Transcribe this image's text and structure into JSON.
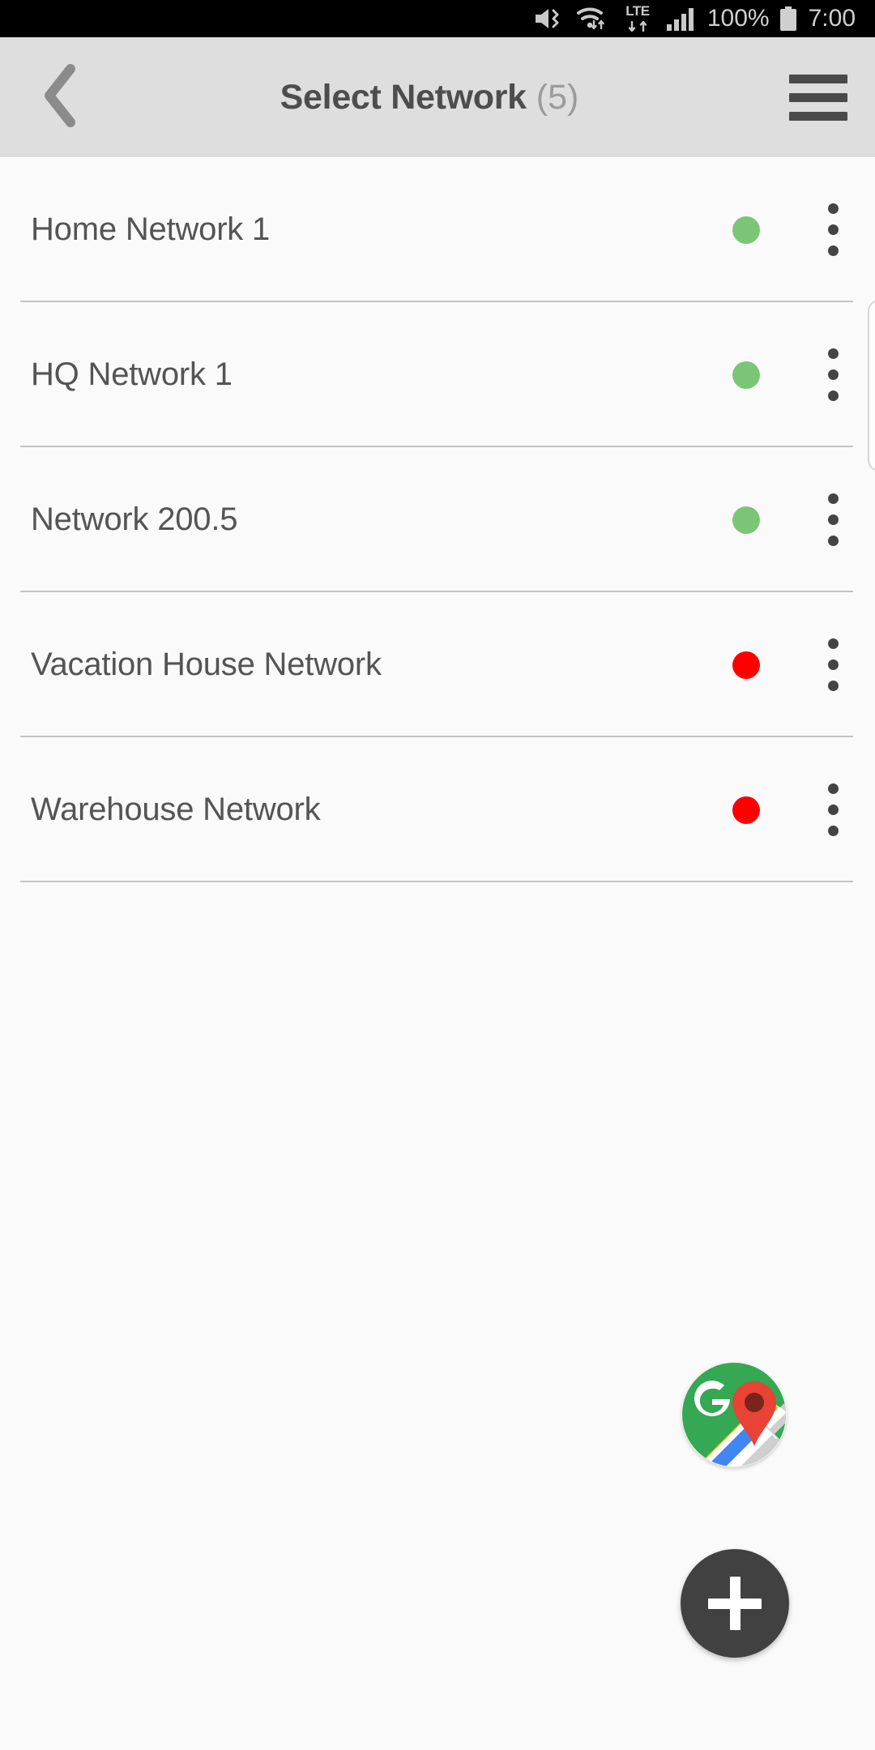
{
  "status_bar": {
    "icons": [
      "mute-icon",
      "wifi-icon",
      "lte-icon",
      "signal-bars-icon",
      "battery-icon"
    ],
    "battery_percent": "100%",
    "lte_label": "LTE",
    "time": "7:00"
  },
  "app_bar": {
    "back_icon": "chevron-left-icon",
    "title": "Select Network",
    "count": "(5)",
    "menu_icon": "hamburger-menu-icon"
  },
  "network_list": {
    "rows": [
      {
        "name": "Home Network 1",
        "status": "online",
        "status_color": "#7cc576",
        "menu_icon": "more-vertical-icon"
      },
      {
        "name": "HQ Network 1",
        "status": "online",
        "status_color": "#7cc576",
        "menu_icon": "more-vertical-icon"
      },
      {
        "name": "Network 200.5",
        "status": "online",
        "status_color": "#7cc576",
        "menu_icon": "more-vertical-icon"
      },
      {
        "name": "Vacation House Network",
        "status": "offline",
        "status_color": "#fe0000",
        "menu_icon": "more-vertical-icon"
      },
      {
        "name": "Warehouse Network",
        "status": "offline",
        "status_color": "#fe0000",
        "menu_icon": "more-vertical-icon"
      }
    ]
  },
  "floating_buttons": {
    "maps_icon": "google-maps-icon",
    "add_icon": "plus-icon",
    "add_bg_color": "#414141"
  },
  "colors": {
    "app_bar_bg": "#dedede",
    "page_bg": "#fafafa",
    "title_text": "#4d4d4d",
    "count_text": "#9b9b9b",
    "row_text": "#545454",
    "divider": "#c4c4c4",
    "online": "#7cc576",
    "offline": "#fe0000"
  }
}
